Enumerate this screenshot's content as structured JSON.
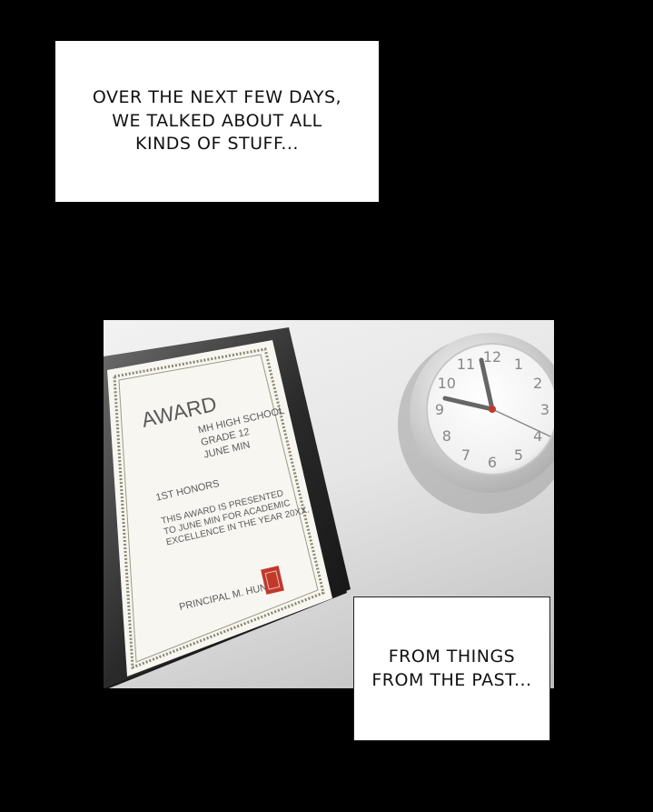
{
  "captions": {
    "top": "OVER THE NEXT FEW DAYS,\nWE TALKED ABOUT ALL\nKINDS OF STUFF...",
    "bottom": "FROM THINGS\nFROM THE PAST..."
  },
  "certificate": {
    "title": "AWARD",
    "school": "MH HIGH SCHOOL",
    "grade": "GRADE 12",
    "recipient": "JUNE MIN",
    "honors": "1ST HONORS",
    "body_line1": "THIS AWARD IS PRESENTED",
    "body_line2": "TO JUNE MIN FOR ACADEMIC",
    "body_line3": "EXCELLENCE IN THE YEAR 20XX.",
    "signature": "PRINCIPAL M. HUNT"
  },
  "clock": {
    "numerals": [
      "12",
      "1",
      "2",
      "3",
      "4",
      "5",
      "6",
      "7",
      "8",
      "9",
      "10",
      "11"
    ]
  },
  "colors": {
    "background": "#000000",
    "caption_bg": "#ffffff",
    "seal": "#c0392b"
  }
}
